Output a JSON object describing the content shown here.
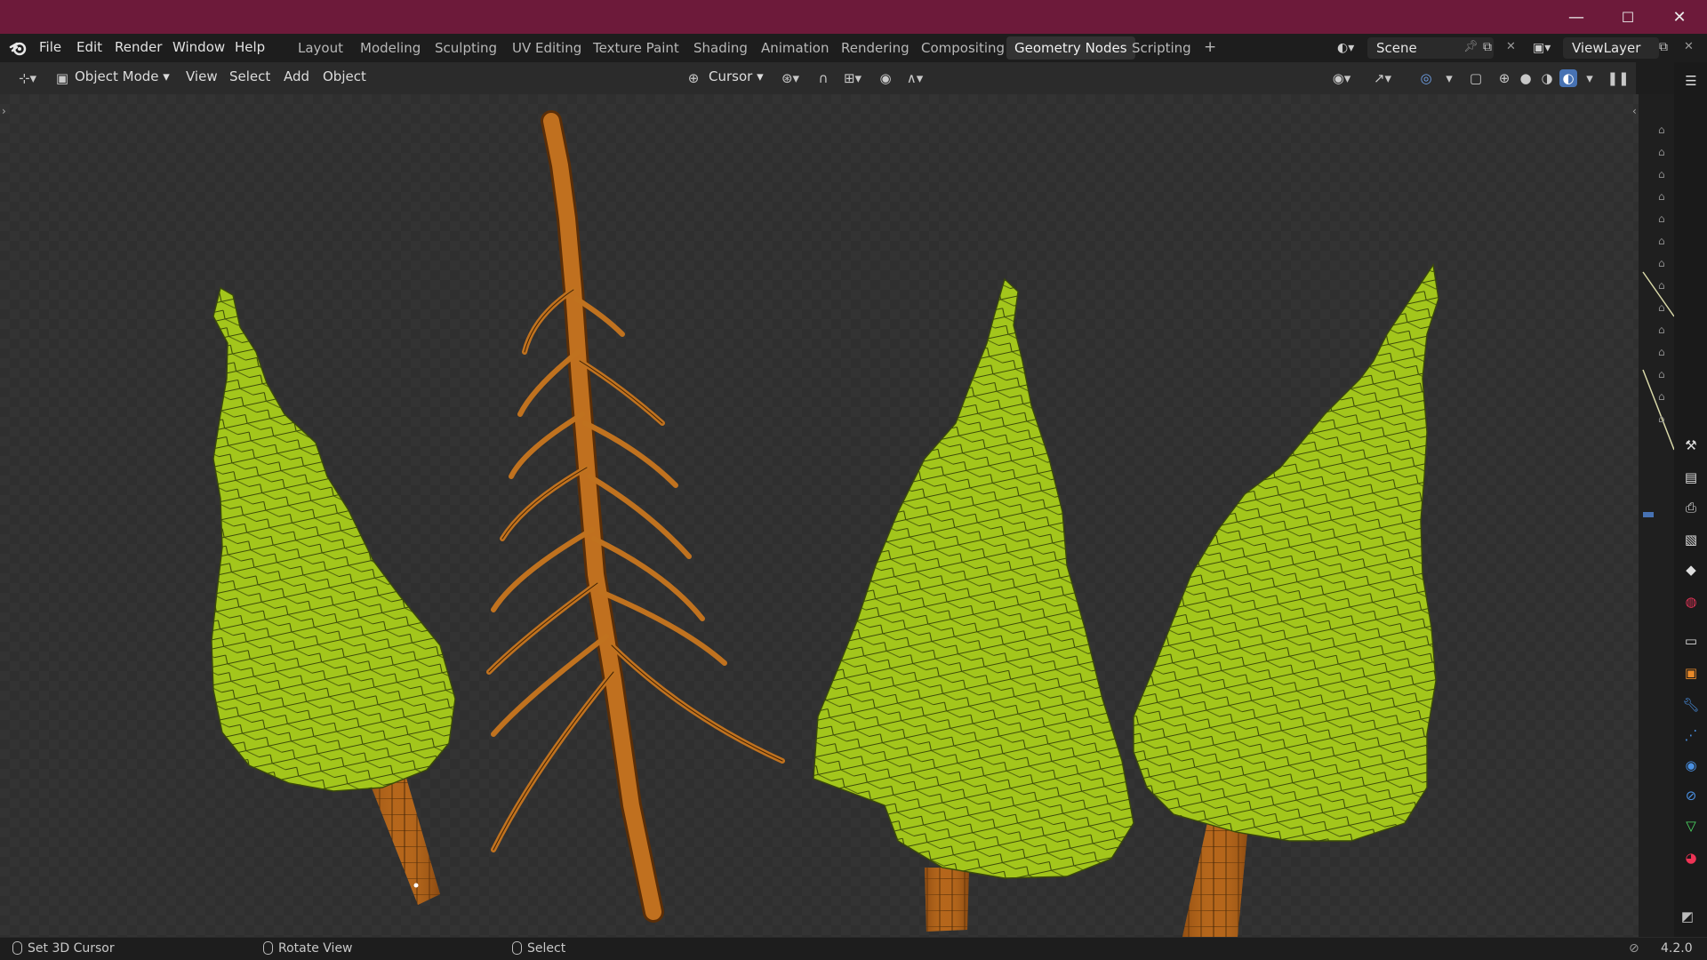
{
  "window": {
    "minimize_glyph": "—",
    "maximize_glyph": "☐",
    "close_glyph": "✕"
  },
  "menu": {
    "items": [
      "File",
      "Edit",
      "Render",
      "Window",
      "Help"
    ]
  },
  "workspaces": {
    "tabs": [
      "Layout",
      "Modeling",
      "Sculpting",
      "UV Editing",
      "Texture Paint",
      "Shading",
      "Animation",
      "Rendering",
      "Compositing",
      "Geometry Nodes",
      "Scripting"
    ],
    "active": "Geometry Nodes",
    "add_glyph": "+"
  },
  "scene": {
    "name": "Scene"
  },
  "view_layer": {
    "name": "ViewLayer"
  },
  "header": {
    "mode": "Object Mode",
    "view": "View",
    "select": "Select",
    "add": "Add",
    "object": "Object",
    "pivot": "Cursor"
  },
  "status": {
    "left": "Set 3D Cursor",
    "middle": "Rotate View",
    "right": "Select",
    "version": "4.2.0"
  },
  "colors": {
    "titlebar": "#6d1a3a",
    "foliage": "#9bc21a",
    "bark": "#b8691c",
    "accent": "#4772b3"
  },
  "icons": {
    "blender": "blender-logo-icon",
    "properties": [
      "tool-icon",
      "render-icon",
      "output-icon",
      "view-layer-icon",
      "scene-icon",
      "world-icon",
      "collection-icon",
      "object-icon",
      "modifier-icon",
      "particles-icon",
      "physics-icon",
      "constraints-icon",
      "data-icon",
      "material-icon"
    ]
  }
}
